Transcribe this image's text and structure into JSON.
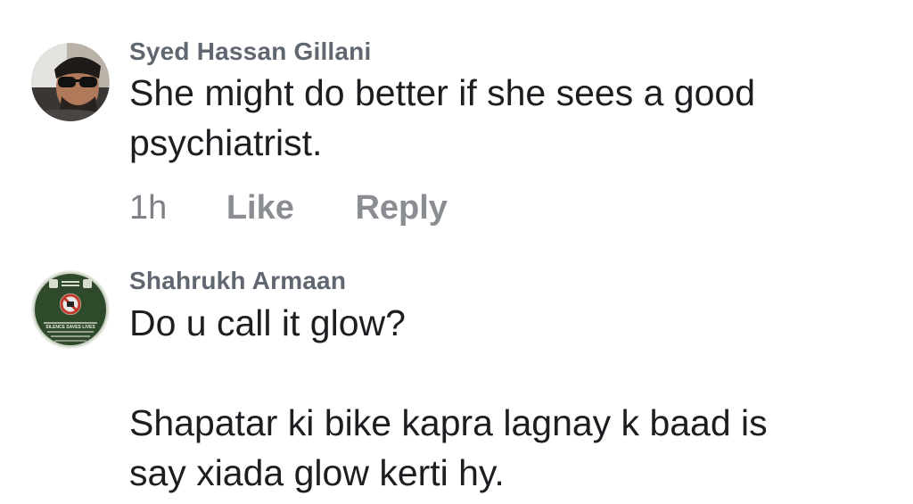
{
  "comments": [
    {
      "author": "Syed Hassan Gillani",
      "text": "She might do better if she sees a good\npsychiatrist.",
      "time": "1h",
      "like_label": "Like",
      "reply_label": "Reply"
    },
    {
      "author": "Shahrukh Armaan",
      "text": "Do u call it glow?\n\nShapatar ki bike kapra lagnay k baad is\nsay xiada glow kerti hy.",
      "avatar_caption": "SILENCE SAVES LIVES"
    }
  ],
  "colors": {
    "author": "#606770",
    "text": "#1c1e21",
    "meta": "#8a8d91",
    "badge_green": "#2f4a2a"
  }
}
